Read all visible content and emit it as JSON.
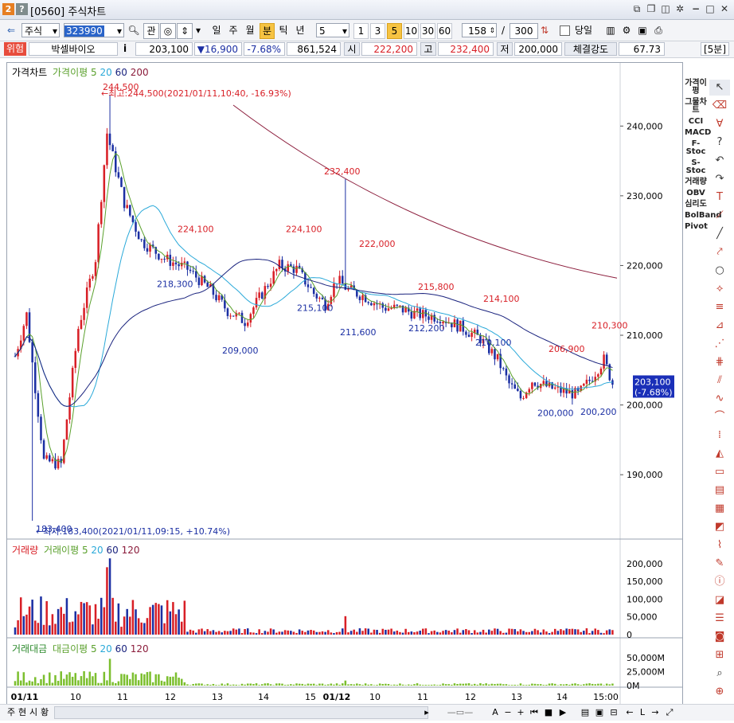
{
  "window": {
    "badge1": "2",
    "badge2": "?",
    "title": "[0560] 주식차트"
  },
  "toolbar": {
    "market": "주식",
    "code": "323990",
    "btn_rel": "관",
    "periods": [
      "일",
      "주",
      "월",
      "분",
      "틱",
      "년"
    ],
    "active_period": "분",
    "interval_value": "5",
    "interval_buttons": [
      "1",
      "3",
      "5",
      "10",
      "30",
      "60"
    ],
    "active_interval": "5",
    "count_value": "158",
    "slash": "/",
    "total_value": "300",
    "today_label": "당일"
  },
  "info": {
    "risk_label": "위험",
    "stock_name": "박셀바이오",
    "i_label": "i",
    "price": "203,100",
    "change": "▼16,900",
    "change_pct": "-7.68%",
    "volume": "861,524",
    "open_label": "시",
    "open": "222,200",
    "high_label": "고",
    "high": "232,400",
    "low_label": "저",
    "low": "200,000",
    "strength_label": "체결강도",
    "strength": "67.73",
    "timeframe": "[5분]"
  },
  "price_panel": {
    "legend": {
      "name": "가격차트",
      "ma_label": "가격이평",
      "ma": [
        "5",
        "20",
        "60",
        "200"
      ]
    },
    "ma_colors": [
      "#5aa02c",
      "#2aa9d9",
      "#1a237e",
      "#8b1c3b"
    ],
    "y_ticks": [
      "240,000",
      "230,000",
      "220,000",
      "210,000",
      "200,000",
      "190,000"
    ],
    "max_note": "←최고:244,500(2021/01/11,10:40, -16.93%)",
    "min_note": "←최저:183,400(2021/01/11,09:15, +10.74%)",
    "current_price": "203,100",
    "current_pct": "(-7.68%)",
    "peak_labels": [
      "244,500",
      "224,100",
      "224,100",
      "232,400",
      "222,000",
      "215,800",
      "214,100",
      "206,900",
      "210,300"
    ],
    "trough_labels": [
      "183,400",
      "218,300",
      "209,000",
      "215,100",
      "211,600",
      "212,200",
      "210,100",
      "200,000",
      "200,200"
    ]
  },
  "volume_panel": {
    "legend": {
      "name": "거래량",
      "ma_label": "거래이평",
      "ma": [
        "5",
        "20",
        "60",
        "120"
      ]
    },
    "y_ticks": [
      "200,000",
      "150,000",
      "100,000",
      "50,000",
      "0"
    ]
  },
  "amount_panel": {
    "legend": {
      "name": "거래대금",
      "ma_label": "대금이평",
      "ma": [
        "5",
        "20",
        "60",
        "120"
      ]
    },
    "y_ticks": [
      "50,000M",
      "25,000M",
      "0M"
    ]
  },
  "x_axis": {
    "labels": [
      "01/11",
      "10",
      "11",
      "12",
      "13",
      "14",
      "15",
      "01/12",
      "10",
      "11",
      "12",
      "13",
      "14",
      "15:00"
    ]
  },
  "right_panel": {
    "items": [
      "가격이평",
      "그물차트",
      "CCI",
      "MACD",
      "F-Stoc",
      "S-Stoc",
      "거래량",
      "OBV",
      "심리도",
      "BolBand",
      "Pivot"
    ]
  },
  "bottom": {
    "tabs": [
      "주",
      "현",
      "시",
      "황"
    ],
    "zoom_label": "A"
  },
  "colors": {
    "up": "#d81f26",
    "down": "#1b2fa3",
    "accent": "#f6c342",
    "current_bg": "#1a2fb8"
  },
  "chart_data": {
    "type": "candlestick",
    "x_axis_labels": [
      "01/11",
      "10",
      "11",
      "12",
      "13",
      "14",
      "15",
      "01/12",
      "10",
      "11",
      "12",
      "13",
      "14",
      "15:00"
    ],
    "y_range": [
      181000,
      247000
    ],
    "max_label": {
      "value": 244500
    },
    "min_label": {
      "value": 183400
    },
    "current": {
      "value": 203100
    }
  }
}
